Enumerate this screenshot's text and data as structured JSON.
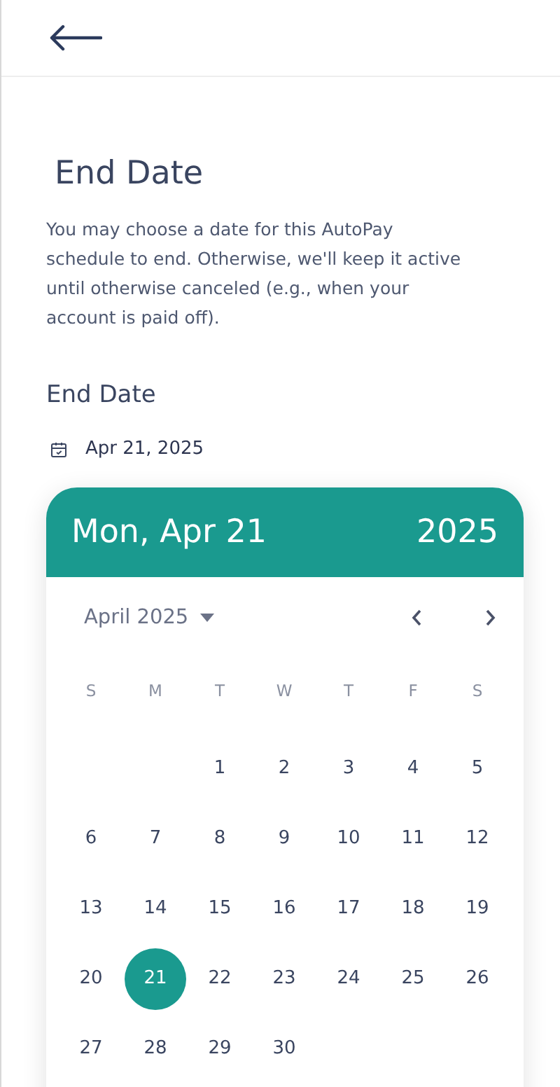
{
  "title": "End Date",
  "description": "You may choose a date for this AutoPay schedule to end. Otherwise, we'll keep it active until otherwise canceled (e.g., when your account is paid off).",
  "field": {
    "label": "End Date",
    "value": "Apr 21, 2025"
  },
  "calendar": {
    "selected_date": "Mon, Apr 21",
    "year": "2025",
    "month": "April 2025",
    "weekdays": [
      "S",
      "M",
      "T",
      "W",
      "T",
      "F",
      "S"
    ],
    "weeks": [
      {
        "kind": "right",
        "days": [
          {
            "label": "1",
            "selected": false
          },
          {
            "label": "2",
            "selected": false
          },
          {
            "label": "3",
            "selected": false
          },
          {
            "label": "4",
            "selected": false
          },
          {
            "label": "5",
            "selected": false
          }
        ]
      },
      {
        "kind": "left",
        "days": [
          {
            "label": "6",
            "selected": false
          },
          {
            "label": "7",
            "selected": false
          },
          {
            "label": "8",
            "selected": false
          },
          {
            "label": "9",
            "selected": false
          },
          {
            "label": "10",
            "selected": false
          },
          {
            "label": "11",
            "selected": false
          },
          {
            "label": "12",
            "selected": false
          }
        ]
      },
      {
        "kind": "left",
        "days": [
          {
            "label": "13",
            "selected": false
          },
          {
            "label": "14",
            "selected": false
          },
          {
            "label": "15",
            "selected": false
          },
          {
            "label": "16",
            "selected": false
          },
          {
            "label": "17",
            "selected": false
          },
          {
            "label": "18",
            "selected": false
          },
          {
            "label": "19",
            "selected": false
          }
        ]
      },
      {
        "kind": "left",
        "days": [
          {
            "label": "20",
            "selected": false
          },
          {
            "label": "21",
            "selected": true
          },
          {
            "label": "22",
            "selected": false
          },
          {
            "label": "23",
            "selected": false
          },
          {
            "label": "24",
            "selected": false
          },
          {
            "label": "25",
            "selected": false
          },
          {
            "label": "26",
            "selected": false
          }
        ]
      },
      {
        "kind": "left",
        "days": [
          {
            "label": "27",
            "selected": false
          },
          {
            "label": "28",
            "selected": false
          },
          {
            "label": "29",
            "selected": false
          },
          {
            "label": "30",
            "selected": false
          }
        ]
      }
    ]
  }
}
